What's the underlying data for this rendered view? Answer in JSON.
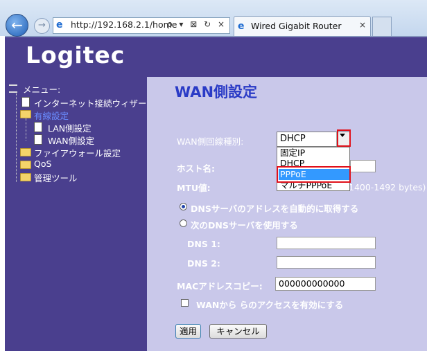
{
  "browser": {
    "url": "http://192.168.2.1/home",
    "tab_title": "Wired Gigabit Router",
    "tab_close": "×",
    "address_tools": "ρ ▾ ⊠ ↻ ×"
  },
  "header": {
    "logo": "Logitec"
  },
  "sidebar": {
    "menu_title": "メニュー:",
    "items": [
      {
        "label": "インターネット接続ウィザード"
      },
      {
        "label": "有線設定"
      },
      {
        "label": "LAN側設定"
      },
      {
        "label": "WAN側設定"
      },
      {
        "label": "ファイアウォール設定"
      },
      {
        "label": "QoS"
      },
      {
        "label": "管理ツール"
      }
    ]
  },
  "main": {
    "title": "WAN側設定",
    "wan_type_label": "WAN側回線種別:",
    "wan_type_value": "DHCP",
    "wan_type_options": [
      "固定IP",
      "DHCP",
      "PPPoE",
      "マルチPPPoE"
    ],
    "host_label": "ホスト名:",
    "mtu_label": "MTU値:",
    "mtu_hint": "1400-1492 bytes)",
    "dns_auto_label": "DNSサーバのアドレスを自動的に取得する",
    "dns_manual_label": "次のDNSサーバを使用する",
    "dns1_label": "DNS 1:",
    "dns2_label": "DNS 2:",
    "mac_label": "MACアドレスコピー:",
    "mac_value": "000000000000",
    "wan_access_label": "WANから らのアクセスを有効にする",
    "apply_label": "適用",
    "cancel_label": "キャンセル"
  },
  "colors": {
    "accent": "#4a3f8e",
    "highlight": "#e0101a",
    "selection": "#3399ff",
    "title": "#2a3bc6"
  }
}
